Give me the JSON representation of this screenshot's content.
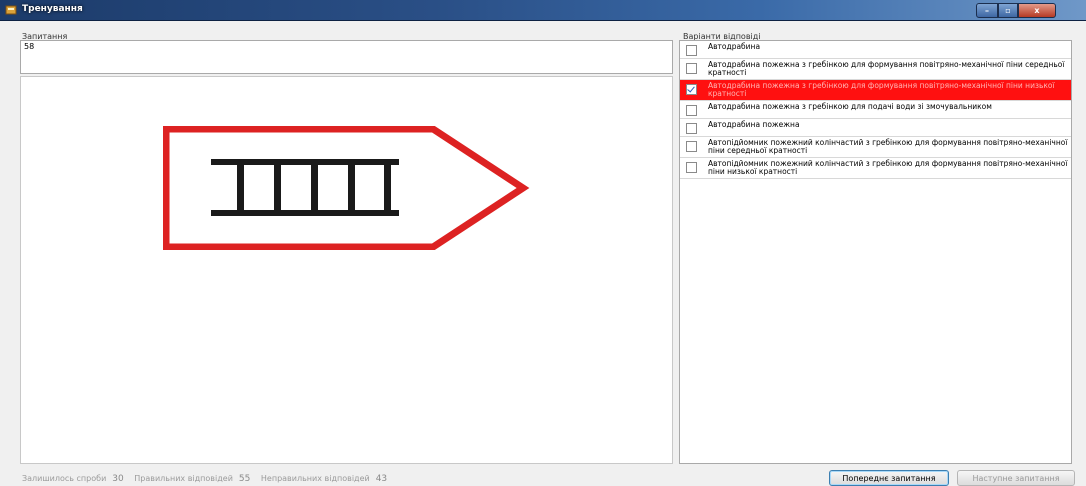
{
  "window": {
    "title": "Тренування",
    "controls": {
      "minimize": "–",
      "maximize": "▫",
      "close": "x"
    }
  },
  "question": {
    "label": "Запитання",
    "number": "58",
    "image_icon": "fire-ladder-truck-sign-icon"
  },
  "answers": {
    "label": "Варіанти відповіді",
    "items": [
      {
        "text": "Автодрабина",
        "checked": false,
        "selected": false
      },
      {
        "text": "Автодрабина пожежна з гребінкою для формування повітряно-механічної піни середньої кратності",
        "checked": false,
        "selected": false
      },
      {
        "text": "Автодрабина пожежна з гребінкою для формування повітряно-механічної піни низької кратності",
        "checked": true,
        "selected": true
      },
      {
        "text": "Автодрабина пожежна з гребінкою для подачі води зі змочувальником",
        "checked": false,
        "selected": false
      },
      {
        "text": "Автодрабина пожежна",
        "checked": false,
        "selected": false
      },
      {
        "text": "Автопідйомник пожежний колінчастий з гребінкою для формування повітряно-механічної піни середньої кратності",
        "checked": false,
        "selected": false
      },
      {
        "text": "Автопідйомник пожежний колінчастий з гребінкою для формування повітряно-механічної піни низької кратності",
        "checked": false,
        "selected": false
      }
    ],
    "selected_color": "#ff1010"
  },
  "status": {
    "remaining_label": "Залишилось спроби",
    "remaining_value": "30",
    "correct_label": "Правильних відповідей",
    "correct_value": "55",
    "incorrect_label": "Неправильних відповідей",
    "incorrect_value": "43"
  },
  "buttons": {
    "prev": "Попереднє запитання",
    "next": "Наступне запитання"
  }
}
